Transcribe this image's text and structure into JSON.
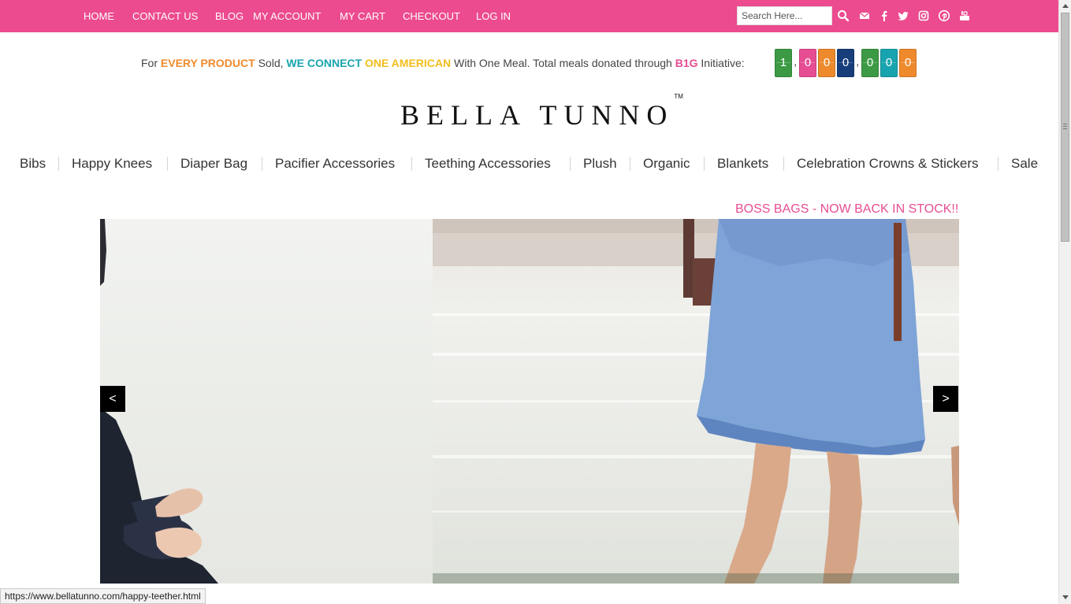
{
  "topnav": {
    "home": "HOME",
    "contact": "CONTACT US",
    "blog": "BLOG",
    "account": "MY ACCOUNT",
    "cart": "MY CART",
    "checkout": "CHECKOUT",
    "login": "LOG IN"
  },
  "search": {
    "placeholder": "Search Here..."
  },
  "social_icons": [
    "search-icon",
    "envelope-icon",
    "facebook-icon",
    "twitter-icon",
    "instagram-icon",
    "pinterest-icon",
    "youtube-icon"
  ],
  "promo": {
    "for": "For ",
    "every_product": "EVERY PRODUCT",
    "sold": " Sold, ",
    "we_connect": "WE CONNECT",
    "one_american": "ONE AMERICAN",
    "rest": " With One Meal. Total meals donated through ",
    "b1g": "B1G",
    "initiative": " Initiative:"
  },
  "counter": {
    "digits": [
      "1",
      "0",
      "0",
      "0",
      "0",
      "0",
      "0"
    ],
    "colors": [
      "#3c9a44",
      "#e64d93",
      "#ee8a2c",
      "#173d7a",
      "#3c9a44",
      "#18a4ae",
      "#ee8a2c"
    ]
  },
  "logo": {
    "text": "BELLA TUNNO",
    "tm": "TM"
  },
  "categories": {
    "bibs": "Bibs",
    "happy_knees": "Happy Knees",
    "diaper_bag": "Diaper Bag",
    "pacifier": "Pacifier Accessories",
    "teething": "Teething Accessories",
    "plush": "Plush",
    "organic": "Organic",
    "blankets": "Blankets",
    "crowns": "Celebration Crowns & Stickers",
    "sale": "Sale"
  },
  "banner": {
    "boss_bags": "BOSS BAGS - NOW BACK IN STOCK!!"
  },
  "slider": {
    "prev": "<",
    "next": ">"
  },
  "statusbar": {
    "url": "https://www.bellatunno.com/happy-teether.html"
  },
  "colors": {
    "brand_pink": "#ec4b8f",
    "orange": "#ee8a2c",
    "teal": "#18a4ae",
    "yellow": "#f2be1e"
  }
}
